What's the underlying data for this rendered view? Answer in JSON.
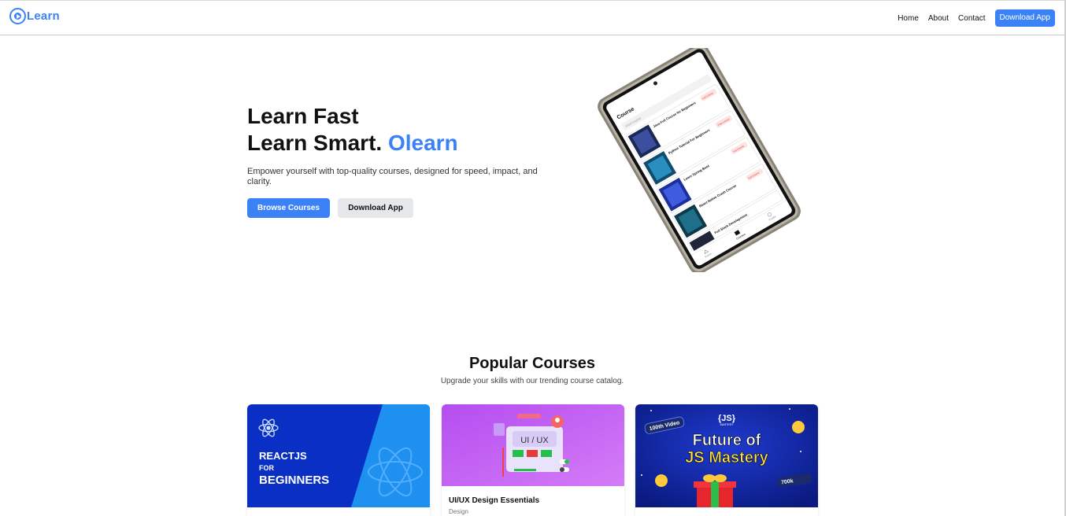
{
  "brand": {
    "name": "Learn"
  },
  "nav": {
    "links": [
      "Home",
      "About",
      "Contact"
    ],
    "cta": "Download App"
  },
  "hero": {
    "line1": "Learn Fast",
    "line2": "Learn Smart.",
    "accent": "Olearn",
    "subtitle": "Empower yourself with top-quality courses, designed for speed, impact, and clarity.",
    "primary_button": "Browse Courses",
    "secondary_button": "Download App"
  },
  "phone_screen": {
    "header": "Course",
    "search_placeholder": "Find Course",
    "items": [
      {
        "title": "Java Full Course for Beginners",
        "tag": "Full Course"
      },
      {
        "title": "Python Tutorial For Beginners",
        "tag": "Free Course"
      },
      {
        "title": "Learn Spring Boot",
        "tag": "Full Course"
      },
      {
        "title": "React Native Crash Course",
        "tag": "Full Course"
      },
      {
        "title": "Full Stack Development",
        "tag": ""
      }
    ],
    "tabs": [
      "Home",
      "Courses",
      "Profile"
    ]
  },
  "popular": {
    "title": "Popular Courses",
    "subtitle": "Upgrade your skills with our trending course catalog."
  },
  "courses": [
    {
      "thumb_lines": [
        "REACTJS",
        "FOR",
        "BEGINNERS"
      ],
      "title": "",
      "category": ""
    },
    {
      "thumb_label": "UI / UX",
      "title": "UI/UX Design Essentials",
      "category": "Design"
    },
    {
      "thumb_badge": "100th Video",
      "thumb_logo": "{JS}",
      "thumb_logo_sub": "MASTERY",
      "thumb_line1": "Future of",
      "thumb_line2": "JS Mastery",
      "thumb_count": "700k",
      "title": "",
      "category": ""
    }
  ],
  "colors": {
    "accent": "#3b82f6",
    "button_secondary": "#e5e7eb"
  }
}
